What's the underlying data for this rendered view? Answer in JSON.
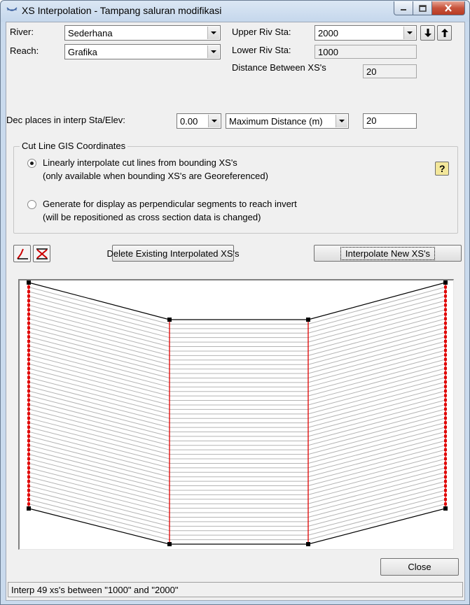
{
  "window": {
    "title": "XS Interpolation  - Tampang saluran modifikasi",
    "controls": [
      "minimize-icon",
      "maximize-icon",
      "close-icon"
    ]
  },
  "river": {
    "label": "River:",
    "value": "Sederhana"
  },
  "reach": {
    "label": "Reach:",
    "value": "Grafika"
  },
  "upper_riv_sta": {
    "label": "Upper Riv Sta:",
    "value": "2000"
  },
  "lower_riv_sta": {
    "label": "Lower Riv Sta:",
    "value": "1000"
  },
  "distance_between": {
    "label": "Distance Between XS's",
    "value": "20"
  },
  "dec_places": {
    "label": "Dec places in interp Sta/Elev:",
    "value": "0.00"
  },
  "max_distance": {
    "select_value": "Maximum Distance (m)",
    "value": "20"
  },
  "cut_line": {
    "group_title": "Cut Line GIS Coordinates",
    "option1_line1": "Linearly interpolate cut lines from bounding XS's",
    "option1_line2": "(only available when bounding XS's are Georeferenced)",
    "option2_line1": "Generate for display as perpendicular segments to reach invert",
    "option2_line2": "(will be repositioned as cross section data is changed)",
    "selected": "option1"
  },
  "buttons": {
    "delete_label": "Delete Existing Interpolated XS's",
    "interpolate_label": "Interpolate New XS's",
    "close_label": "Close"
  },
  "status_text": "Interp 49 xs's between \"1000\" and \"2000\"",
  "interpolated_count": 49,
  "colors": {
    "bounding_xs": "#e00000",
    "interp_line": "#b4b4b4",
    "outline": "#000000"
  }
}
